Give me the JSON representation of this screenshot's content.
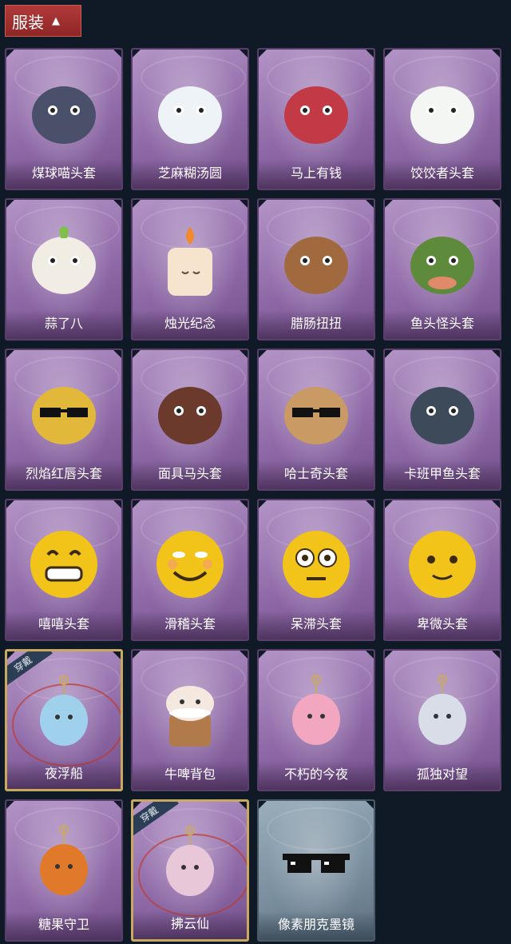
{
  "header": {
    "title": "服装",
    "chevron": "chevron-up-icon"
  },
  "badge_text": "穿戴",
  "items": [
    {
      "label": "煤球喵头套",
      "icon": "black-cat-head",
      "color": "#4a4f6a"
    },
    {
      "label": "芝麻糊汤圆",
      "icon": "rice-ball-head",
      "color": "#eef3f8"
    },
    {
      "label": "马上有钱",
      "icon": "red-horse-head",
      "color": "#c23a45"
    },
    {
      "label": "饺饺者头套",
      "icon": "dumpling-head",
      "color": "#f4f6f4"
    },
    {
      "label": "蒜了八",
      "icon": "garlic-head",
      "color": "#f1ede4"
    },
    {
      "label": "烛光纪念",
      "icon": "candle-head",
      "color": "#f6e4cf"
    },
    {
      "label": "腊肠扭扭",
      "icon": "dachshund-head",
      "color": "#a06a3e"
    },
    {
      "label": "鱼头怪头套",
      "icon": "fish-head",
      "color": "#5e8a3c"
    },
    {
      "label": "烈焰红唇头套",
      "icon": "pikachu-sunglasses-head",
      "color": "#e2b83a"
    },
    {
      "label": "面具马头套",
      "icon": "horse-mask-head",
      "color": "#6b3a2c"
    },
    {
      "label": "哈士奇头套",
      "icon": "husky-sunglasses-head",
      "color": "#c99a63"
    },
    {
      "label": "卡班甲鱼头套",
      "icon": "turtle-head",
      "color": "#3c4a5a"
    },
    {
      "label": "嘻嘻头套",
      "icon": "grin-emoji-head",
      "color": "#f2c318"
    },
    {
      "label": "滑稽头套",
      "icon": "smirk-emoji-head",
      "color": "#f2c318"
    },
    {
      "label": "呆滞头套",
      "icon": "blank-stare-emoji-head",
      "color": "#f2c318"
    },
    {
      "label": "卑微头套",
      "icon": "humble-emoji-head",
      "color": "#f2c318"
    },
    {
      "label": "夜浮船",
      "icon": "jellyfish-charm",
      "color": "#9fd0ec",
      "worn": true
    },
    {
      "label": "牛啤背包",
      "icon": "cow-beer-backpack",
      "color": "#b07a4a"
    },
    {
      "label": "不朽的今夜",
      "icon": "pink-cat-bowl-charm",
      "color": "#f3a6c0"
    },
    {
      "label": "孤独对望",
      "icon": "silver-doll-charm",
      "color": "#d8dde8"
    },
    {
      "label": "糖果守卫",
      "icon": "pumpkin-scarecrow-charm",
      "color": "#e07a2a"
    },
    {
      "label": "拂云仙",
      "icon": "cloud-fairy-charm",
      "color": "#e8c8d8",
      "worn": true
    },
    {
      "label": "像素朋克墨镜",
      "icon": "pixel-sunglasses",
      "color": "#111111",
      "blue": true
    }
  ]
}
